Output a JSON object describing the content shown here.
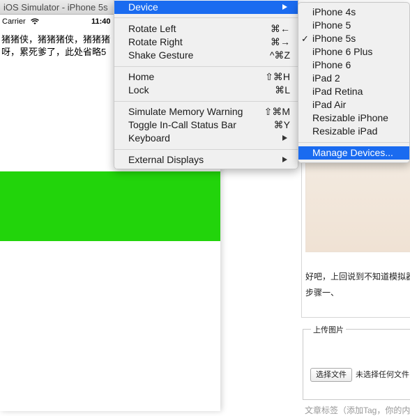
{
  "simulator": {
    "title": "iOS Simulator - iPhone 5s",
    "carrier": "Carrier",
    "clock": "11:40",
    "line1": "猪猪侠，猪猪猪侠，猪猪猪",
    "line2": "呀，累死爹了，此处省略5"
  },
  "menu": {
    "device": {
      "label": "Device"
    },
    "rotate_left": {
      "label": "Rotate Left",
      "shortcut": "⌘←"
    },
    "rotate_right": {
      "label": "Rotate Right",
      "shortcut": "⌘→"
    },
    "shake": {
      "label": "Shake Gesture",
      "shortcut": "^⌘Z"
    },
    "home": {
      "label": "Home",
      "shortcut": "⇧⌘H"
    },
    "lock": {
      "label": "Lock",
      "shortcut": "⌘L"
    },
    "memory_warning": {
      "label": "Simulate Memory Warning",
      "shortcut": "⇧⌘M"
    },
    "in_call": {
      "label": "Toggle In-Call Status Bar",
      "shortcut": "⌘Y"
    },
    "keyboard": {
      "label": "Keyboard"
    },
    "external_displays": {
      "label": "External Displays"
    }
  },
  "submenu": {
    "items": [
      "iPhone 4s",
      "iPhone 5",
      "iPhone 5s",
      "iPhone 6 Plus",
      "iPhone 6",
      "iPad 2",
      "iPad Retina",
      "iPad Air",
      "Resizable iPhone",
      "Resizable iPad"
    ],
    "checked": "✓",
    "manage": "Manage Devices..."
  },
  "page": {
    "paragraph1": "好吧，上回说到不知道模拟器",
    "paragraph2": "步骤一、",
    "upload_legend": "上传图片",
    "file_button": "选择文件",
    "file_none": "未选择任何文件",
    "bottom_text": "文章标签（添加Tag，你的内"
  },
  "colors": {
    "highlight": "#1a6bf0",
    "green_block": "#22d40b"
  }
}
